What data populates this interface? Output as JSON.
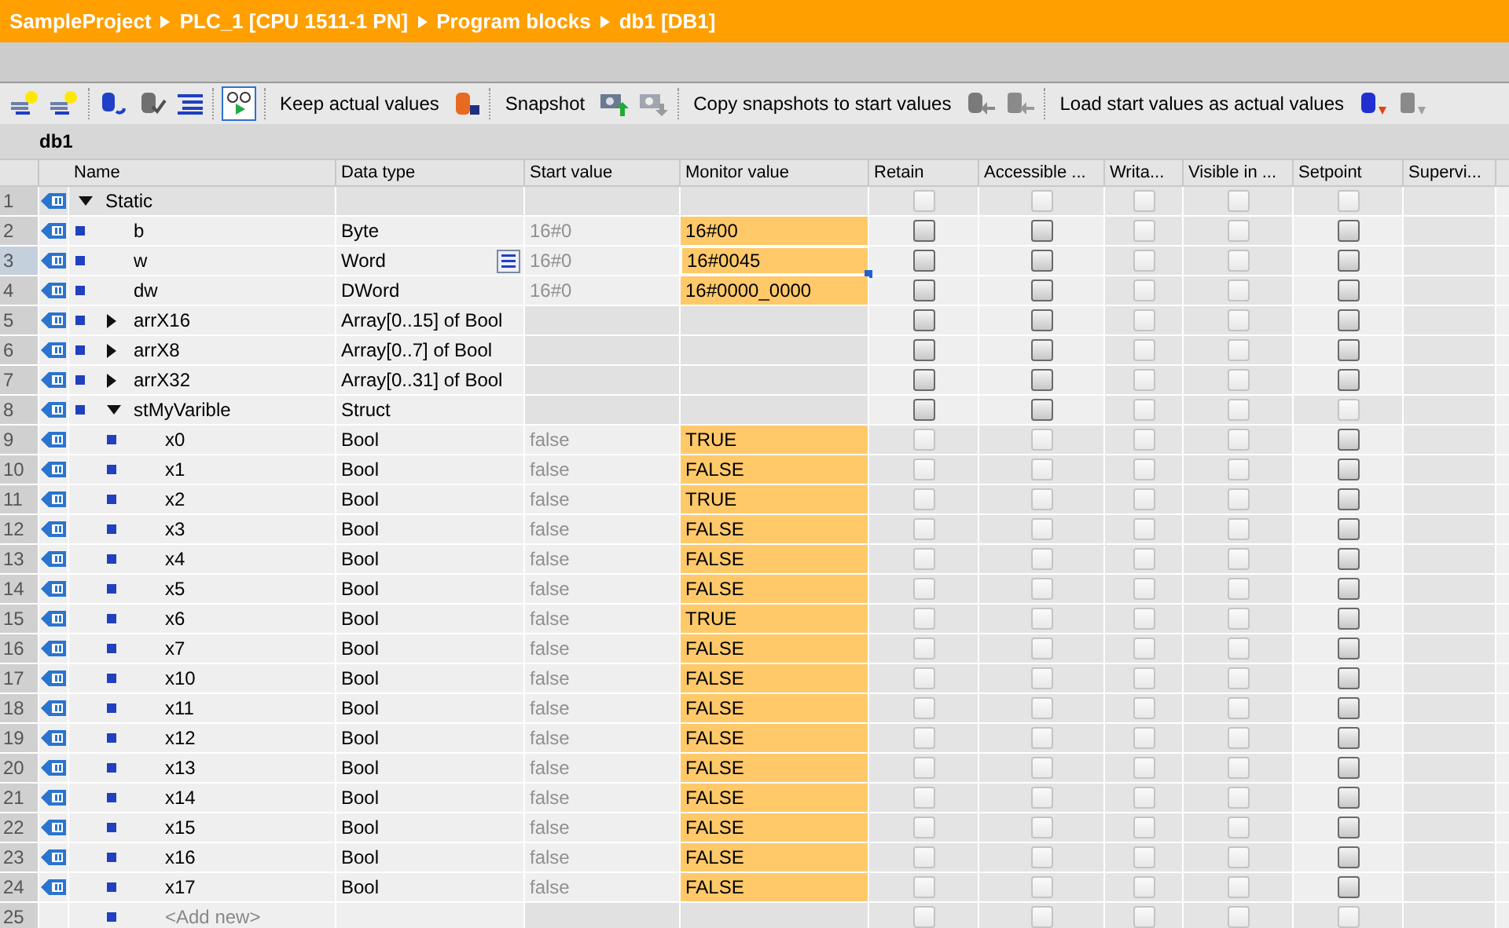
{
  "breadcrumb": [
    "SampleProject",
    "PLC_1 [CPU 1511-1 PN]",
    "Program blocks",
    "db1 [DB1]"
  ],
  "toolbar": {
    "monitor_on": true,
    "labels": [
      "Keep actual values",
      "Snapshot",
      "Copy snapshots to start values",
      "Load start values as actual values"
    ]
  },
  "block_title": "db1",
  "columns": [
    "Name",
    "Data type",
    "Start value",
    "Monitor value",
    "Retain",
    "Accessible ...",
    "Writa...",
    "Visible in ...",
    "Setpoint",
    "Supervi..."
  ],
  "rows": [
    {
      "number": "1",
      "kind": "section",
      "name": "Static",
      "expanded": true,
      "selected": false,
      "checkboxes": [
        {
          "checked": false,
          "enabled": false
        },
        {
          "checked": false,
          "enabled": false
        },
        {
          "checked": false,
          "enabled": false
        },
        {
          "checked": false,
          "enabled": false
        },
        {
          "checked": false,
          "enabled": false
        }
      ],
      "children": [
        {
          "number": "2",
          "kind": "tag",
          "name": "b",
          "data_type": "Byte",
          "start_value": "16#0",
          "monitor_value": "16#00",
          "selected": false,
          "checkboxes": [
            {
              "checked": false,
              "enabled": true
            },
            {
              "checked": false,
              "enabled": true
            },
            {
              "checked": false,
              "enabled": false
            },
            {
              "checked": false,
              "enabled": false
            },
            {
              "checked": false,
              "enabled": true
            }
          ]
        },
        {
          "number": "3",
          "kind": "tag",
          "name": "w",
          "data_type": "Word",
          "start_value": "16#0",
          "monitor_value": "16#0045",
          "selected": true,
          "checkboxes": [
            {
              "checked": false,
              "enabled": true
            },
            {
              "checked": false,
              "enabled": true
            },
            {
              "checked": false,
              "enabled": false
            },
            {
              "checked": false,
              "enabled": false
            },
            {
              "checked": false,
              "enabled": true
            }
          ]
        },
        {
          "number": "4",
          "kind": "tag",
          "name": "dw",
          "data_type": "DWord",
          "start_value": "16#0",
          "monitor_value": "16#0000_0000",
          "selected": false,
          "checkboxes": [
            {
              "checked": false,
              "enabled": true
            },
            {
              "checked": false,
              "enabled": true
            },
            {
              "checked": false,
              "enabled": false
            },
            {
              "checked": false,
              "enabled": false
            },
            {
              "checked": false,
              "enabled": true
            }
          ]
        },
        {
          "number": "5",
          "kind": "tag",
          "name": "arrX16",
          "data_type": "Array[0..15] of Bool",
          "expanded": false,
          "selected": false,
          "checkboxes": [
            {
              "checked": false,
              "enabled": true
            },
            {
              "checked": false,
              "enabled": true
            },
            {
              "checked": false,
              "enabled": false
            },
            {
              "checked": false,
              "enabled": false
            },
            {
              "checked": false,
              "enabled": true
            }
          ]
        },
        {
          "number": "6",
          "kind": "tag",
          "name": "arrX8",
          "data_type": "Array[0..7] of Bool",
          "expanded": false,
          "selected": false,
          "checkboxes": [
            {
              "checked": false,
              "enabled": true
            },
            {
              "checked": false,
              "enabled": true
            },
            {
              "checked": false,
              "enabled": false
            },
            {
              "checked": false,
              "enabled": false
            },
            {
              "checked": false,
              "enabled": true
            }
          ]
        },
        {
          "number": "7",
          "kind": "tag",
          "name": "arrX32",
          "data_type": "Array[0..31] of Bool",
          "expanded": false,
          "selected": false,
          "checkboxes": [
            {
              "checked": false,
              "enabled": true
            },
            {
              "checked": false,
              "enabled": true
            },
            {
              "checked": false,
              "enabled": false
            },
            {
              "checked": false,
              "enabled": false
            },
            {
              "checked": false,
              "enabled": true
            }
          ]
        },
        {
          "number": "8",
          "kind": "tag",
          "name": "stMyVarible",
          "data_type": "Struct",
          "expanded": true,
          "selected": false,
          "checkboxes": [
            {
              "checked": false,
              "enabled": true
            },
            {
              "checked": false,
              "enabled": true
            },
            {
              "checked": false,
              "enabled": false
            },
            {
              "checked": false,
              "enabled": false
            },
            {
              "checked": false,
              "enabled": false
            }
          ],
          "children": [
            {
              "number": "9",
              "kind": "tag",
              "name": "x0",
              "data_type": "Bool",
              "start_value": "false",
              "monitor_value": "TRUE",
              "selected": false,
              "checkboxes": [
                {
                  "checked": false,
                  "enabled": false
                },
                {
                  "checked": false,
                  "enabled": false
                },
                {
                  "checked": false,
                  "enabled": false
                },
                {
                  "checked": false,
                  "enabled": false
                },
                {
                  "checked": false,
                  "enabled": true
                }
              ]
            },
            {
              "number": "10",
              "kind": "tag",
              "name": "x1",
              "data_type": "Bool",
              "start_value": "false",
              "monitor_value": "FALSE",
              "selected": false,
              "checkboxes": [
                {
                  "checked": false,
                  "enabled": false
                },
                {
                  "checked": false,
                  "enabled": false
                },
                {
                  "checked": false,
                  "enabled": false
                },
                {
                  "checked": false,
                  "enabled": false
                },
                {
                  "checked": false,
                  "enabled": true
                }
              ]
            },
            {
              "number": "11",
              "kind": "tag",
              "name": "x2",
              "data_type": "Bool",
              "start_value": "false",
              "monitor_value": "TRUE",
              "selected": false,
              "checkboxes": [
                {
                  "checked": false,
                  "enabled": false
                },
                {
                  "checked": false,
                  "enabled": false
                },
                {
                  "checked": false,
                  "enabled": false
                },
                {
                  "checked": false,
                  "enabled": false
                },
                {
                  "checked": false,
                  "enabled": true
                }
              ]
            },
            {
              "number": "12",
              "kind": "tag",
              "name": "x3",
              "data_type": "Bool",
              "start_value": "false",
              "monitor_value": "FALSE",
              "selected": false,
              "checkboxes": [
                {
                  "checked": false,
                  "enabled": false
                },
                {
                  "checked": false,
                  "enabled": false
                },
                {
                  "checked": false,
                  "enabled": false
                },
                {
                  "checked": false,
                  "enabled": false
                },
                {
                  "checked": false,
                  "enabled": true
                }
              ]
            },
            {
              "number": "13",
              "kind": "tag",
              "name": "x4",
              "data_type": "Bool",
              "start_value": "false",
              "monitor_value": "FALSE",
              "selected": false,
              "checkboxes": [
                {
                  "checked": false,
                  "enabled": false
                },
                {
                  "checked": false,
                  "enabled": false
                },
                {
                  "checked": false,
                  "enabled": false
                },
                {
                  "checked": false,
                  "enabled": false
                },
                {
                  "checked": false,
                  "enabled": true
                }
              ]
            },
            {
              "number": "14",
              "kind": "tag",
              "name": "x5",
              "data_type": "Bool",
              "start_value": "false",
              "monitor_value": "FALSE",
              "selected": false,
              "checkboxes": [
                {
                  "checked": false,
                  "enabled": false
                },
                {
                  "checked": false,
                  "enabled": false
                },
                {
                  "checked": false,
                  "enabled": false
                },
                {
                  "checked": false,
                  "enabled": false
                },
                {
                  "checked": false,
                  "enabled": true
                }
              ]
            },
            {
              "number": "15",
              "kind": "tag",
              "name": "x6",
              "data_type": "Bool",
              "start_value": "false",
              "monitor_value": "TRUE",
              "selected": false,
              "checkboxes": [
                {
                  "checked": false,
                  "enabled": false
                },
                {
                  "checked": false,
                  "enabled": false
                },
                {
                  "checked": false,
                  "enabled": false
                },
                {
                  "checked": false,
                  "enabled": false
                },
                {
                  "checked": false,
                  "enabled": true
                }
              ]
            },
            {
              "number": "16",
              "kind": "tag",
              "name": "x7",
              "data_type": "Bool",
              "start_value": "false",
              "monitor_value": "FALSE",
              "selected": false,
              "checkboxes": [
                {
                  "checked": false,
                  "enabled": false
                },
                {
                  "checked": false,
                  "enabled": false
                },
                {
                  "checked": false,
                  "enabled": false
                },
                {
                  "checked": false,
                  "enabled": false
                },
                {
                  "checked": false,
                  "enabled": true
                }
              ]
            },
            {
              "number": "17",
              "kind": "tag",
              "name": "x10",
              "data_type": "Bool",
              "start_value": "false",
              "monitor_value": "FALSE",
              "selected": false,
              "checkboxes": [
                {
                  "checked": false,
                  "enabled": false
                },
                {
                  "checked": false,
                  "enabled": false
                },
                {
                  "checked": false,
                  "enabled": false
                },
                {
                  "checked": false,
                  "enabled": false
                },
                {
                  "checked": false,
                  "enabled": true
                }
              ]
            },
            {
              "number": "18",
              "kind": "tag",
              "name": "x11",
              "data_type": "Bool",
              "start_value": "false",
              "monitor_value": "FALSE",
              "selected": false,
              "checkboxes": [
                {
                  "checked": false,
                  "enabled": false
                },
                {
                  "checked": false,
                  "enabled": false
                },
                {
                  "checked": false,
                  "enabled": false
                },
                {
                  "checked": false,
                  "enabled": false
                },
                {
                  "checked": false,
                  "enabled": true
                }
              ]
            },
            {
              "number": "19",
              "kind": "tag",
              "name": "x12",
              "data_type": "Bool",
              "start_value": "false",
              "monitor_value": "FALSE",
              "selected": false,
              "checkboxes": [
                {
                  "checked": false,
                  "enabled": false
                },
                {
                  "checked": false,
                  "enabled": false
                },
                {
                  "checked": false,
                  "enabled": false
                },
                {
                  "checked": false,
                  "enabled": false
                },
                {
                  "checked": false,
                  "enabled": true
                }
              ]
            },
            {
              "number": "20",
              "kind": "tag",
              "name": "x13",
              "data_type": "Bool",
              "start_value": "false",
              "monitor_value": "FALSE",
              "selected": false,
              "checkboxes": [
                {
                  "checked": false,
                  "enabled": false
                },
                {
                  "checked": false,
                  "enabled": false
                },
                {
                  "checked": false,
                  "enabled": false
                },
                {
                  "checked": false,
                  "enabled": false
                },
                {
                  "checked": false,
                  "enabled": true
                }
              ]
            },
            {
              "number": "21",
              "kind": "tag",
              "name": "x14",
              "data_type": "Bool",
              "start_value": "false",
              "monitor_value": "FALSE",
              "selected": false,
              "checkboxes": [
                {
                  "checked": false,
                  "enabled": false
                },
                {
                  "checked": false,
                  "enabled": false
                },
                {
                  "checked": false,
                  "enabled": false
                },
                {
                  "checked": false,
                  "enabled": false
                },
                {
                  "checked": false,
                  "enabled": true
                }
              ]
            },
            {
              "number": "22",
              "kind": "tag",
              "name": "x15",
              "data_type": "Bool",
              "start_value": "false",
              "monitor_value": "FALSE",
              "selected": false,
              "checkboxes": [
                {
                  "checked": false,
                  "enabled": false
                },
                {
                  "checked": false,
                  "enabled": false
                },
                {
                  "checked": false,
                  "enabled": false
                },
                {
                  "checked": false,
                  "enabled": false
                },
                {
                  "checked": false,
                  "enabled": true
                }
              ]
            },
            {
              "number": "23",
              "kind": "tag",
              "name": "x16",
              "data_type": "Bool",
              "start_value": "false",
              "monitor_value": "FALSE",
              "selected": false,
              "checkboxes": [
                {
                  "checked": false,
                  "enabled": false
                },
                {
                  "checked": false,
                  "enabled": false
                },
                {
                  "checked": false,
                  "enabled": false
                },
                {
                  "checked": false,
                  "enabled": false
                },
                {
                  "checked": false,
                  "enabled": true
                }
              ]
            },
            {
              "number": "24",
              "kind": "tag",
              "name": "x17",
              "data_type": "Bool",
              "start_value": "false",
              "monitor_value": "FALSE",
              "selected": false,
              "checkboxes": [
                {
                  "checked": false,
                  "enabled": false
                },
                {
                  "checked": false,
                  "enabled": false
                },
                {
                  "checked": false,
                  "enabled": false
                },
                {
                  "checked": false,
                  "enabled": false
                },
                {
                  "checked": false,
                  "enabled": true
                }
              ]
            },
            {
              "number": "25",
              "kind": "add",
              "name": "<Add new>",
              "selected": false,
              "checkboxes": [
                {
                  "checked": false,
                  "enabled": false
                },
                {
                  "checked": false,
                  "enabled": false
                },
                {
                  "checked": false,
                  "enabled": false
                },
                {
                  "checked": false,
                  "enabled": false
                },
                {
                  "checked": false,
                  "enabled": false
                }
              ]
            }
          ]
        }
      ]
    }
  ]
}
